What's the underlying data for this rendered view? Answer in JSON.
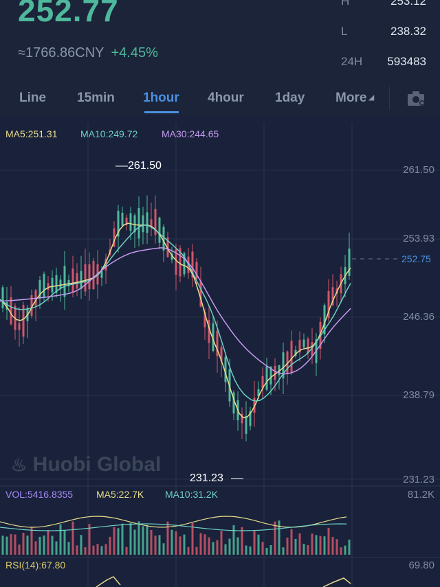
{
  "header": {
    "last_price": "252.77",
    "cny_price": "≈1766.86CNY",
    "change_pct": "+4.45%",
    "stats": [
      {
        "label": "H",
        "value": "253.12"
      },
      {
        "label": "L",
        "value": "238.32"
      },
      {
        "label": "24H",
        "value": "593483"
      }
    ]
  },
  "tabs": [
    {
      "label": "Line"
    },
    {
      "label": "15min"
    },
    {
      "label": "1hour",
      "active": true
    },
    {
      "label": "4hour"
    },
    {
      "label": "1day"
    },
    {
      "label": "More"
    }
  ],
  "ma_legend": {
    "ma5": "MA5:251.31",
    "ma10": "MA10:249.72",
    "ma30": "MA30:244.65"
  },
  "price_axis": [
    "261.50",
    "253.93",
    "246.36",
    "238.79",
    "231.23"
  ],
  "current_price_label": "252.75",
  "high_label": "261.50",
  "low_label": "231.23",
  "watermark": "Huobi Global",
  "volume": {
    "vol": "VOL:5416.8355",
    "ma5": "MA5:22.7K",
    "ma10": "MA10:31.2K",
    "axis_top": "81.2K"
  },
  "rsi": {
    "label": "RSI(14):67.80",
    "axis_top": "69.80"
  },
  "colors": {
    "up": "#4fb89c",
    "down": "#d1576a",
    "accent": "#4a90e2",
    "ma5": "#e8dd8c",
    "ma10": "#6fd0c4",
    "ma30": "#c69af0"
  },
  "icons": [
    "camera-icon"
  ]
}
